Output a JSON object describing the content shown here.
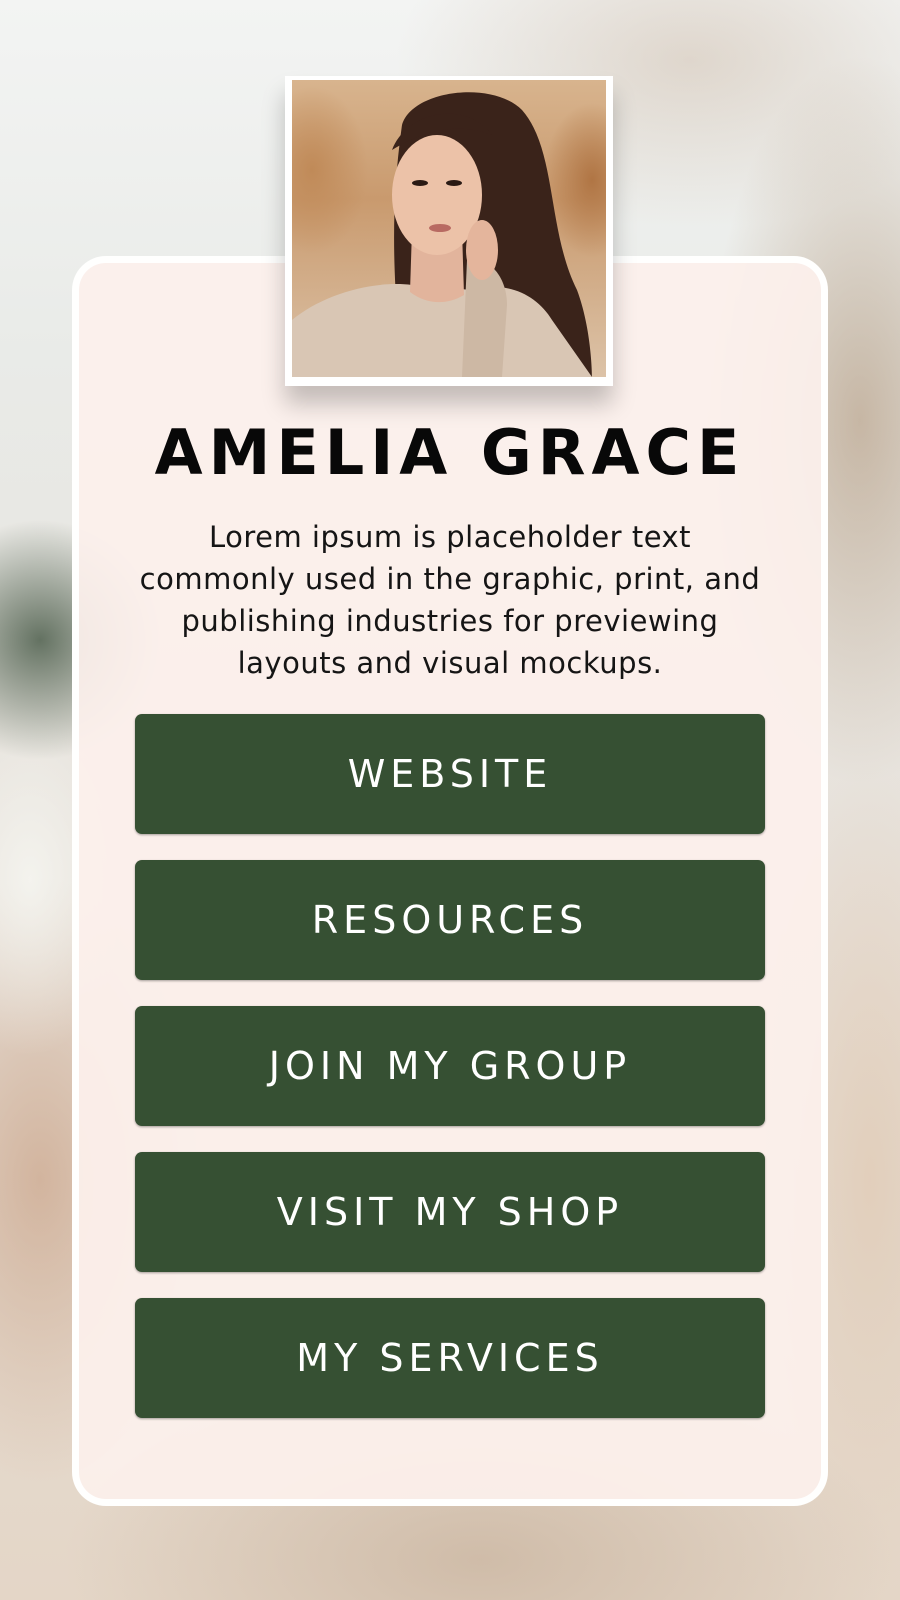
{
  "profile": {
    "name": "AMELIA GRACE",
    "bio": "Lorem ipsum is placeholder text commonly used in the graphic, print, and publishing industries for previewing layouts and visual mockups."
  },
  "links": [
    {
      "label": "WEBSITE"
    },
    {
      "label": "RESOURCES"
    },
    {
      "label": "JOIN MY GROUP"
    },
    {
      "label": "VISIT MY SHOP"
    },
    {
      "label": "MY SERVICES"
    }
  ],
  "colors": {
    "button": "#365033",
    "button_text": "#ffffff",
    "card": "#fcf0ec",
    "name": "#080808"
  }
}
